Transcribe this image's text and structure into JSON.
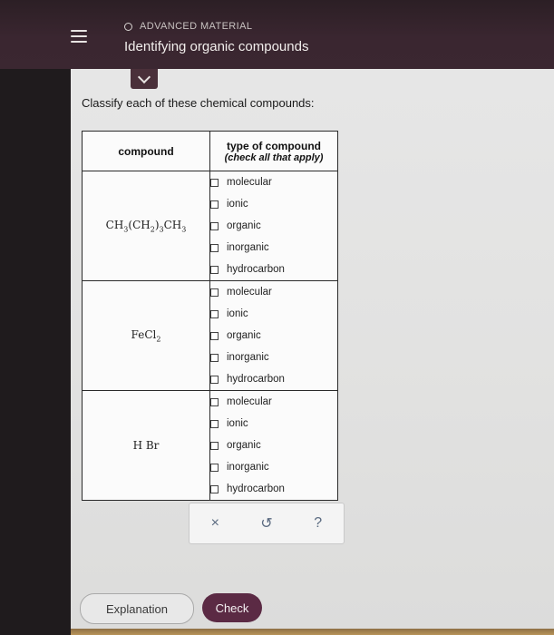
{
  "header": {
    "topic": "ADVANCED MATERIAL",
    "title": "Identifying organic compounds"
  },
  "prompt": "Classify each of these chemical compounds:",
  "table": {
    "col_compound": "compound",
    "col_type": "type of compound",
    "col_type_note": "(check all that apply)",
    "options": [
      "molecular",
      "ionic",
      "organic",
      "inorganic",
      "hydrocarbon"
    ],
    "rows": [
      {
        "formula_parts": [
          "CH",
          "3",
          "(CH",
          "2",
          ")",
          "3",
          "CH",
          "3"
        ]
      },
      {
        "formula_parts": [
          "FeCl",
          "2"
        ]
      },
      {
        "formula_parts": [
          "H Br"
        ]
      }
    ]
  },
  "toolbar": {
    "clear": "×",
    "undo": "↺",
    "help": "?"
  },
  "buttons": {
    "explanation": "Explanation",
    "check": "Check"
  }
}
